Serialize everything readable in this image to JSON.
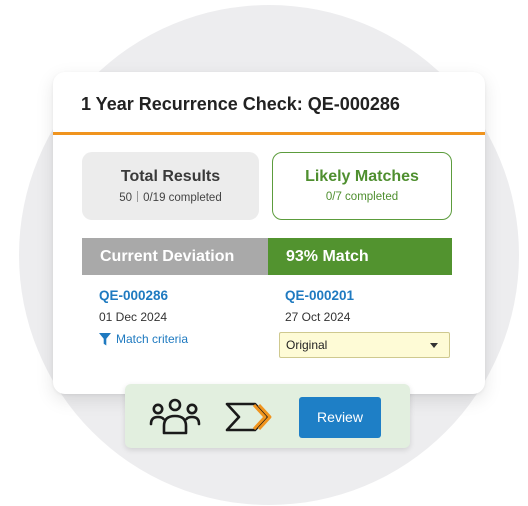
{
  "card": {
    "title": "1 Year Recurrence Check: QE-000286"
  },
  "summary": {
    "total": {
      "title": "Total Results",
      "count": "50",
      "progress": "0/19 completed"
    },
    "likely": {
      "title": "Likely Matches",
      "progress": "0/7 completed"
    }
  },
  "comparison": {
    "current_header": "Current Deviation",
    "match_header": "93% Match",
    "current": {
      "id": "QE-000286",
      "date": "01 Dec 2024",
      "criteria_link": "Match criteria"
    },
    "match": {
      "id": "QE-000201",
      "date": "27 Oct 2024",
      "status_select": "Original"
    }
  },
  "toolbar": {
    "icons": [
      "team-icon",
      "workflow-arrow-icon"
    ],
    "review_label": "Review"
  },
  "colors": {
    "accent_orange": "#f0941e",
    "match_green": "#52932f",
    "link_blue": "#1f7ac0",
    "button_blue": "#1e7fc6",
    "select_yellow": "#fefbd6"
  }
}
